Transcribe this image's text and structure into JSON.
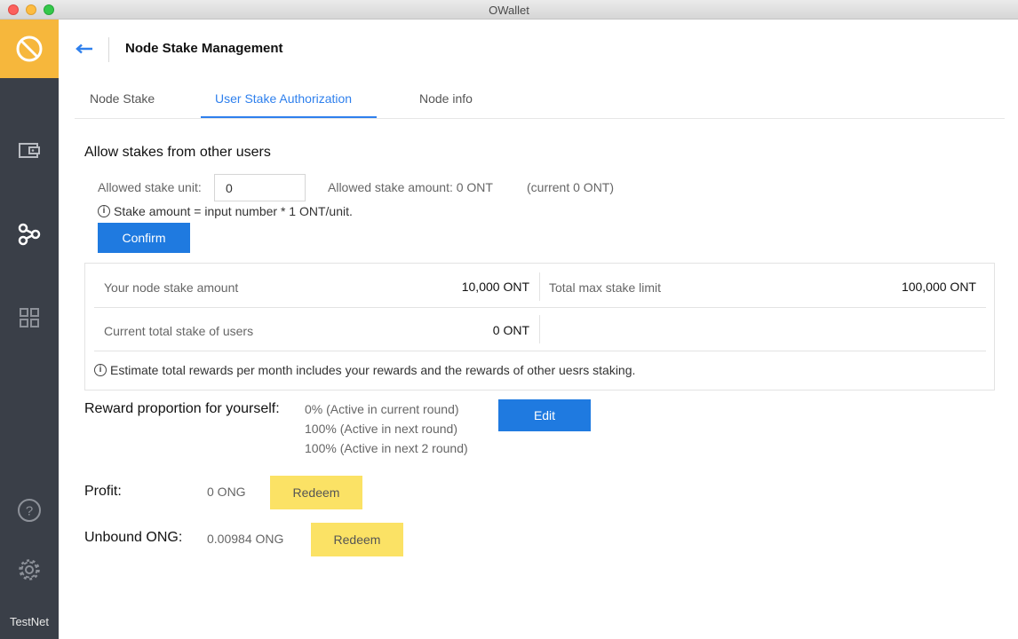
{
  "window": {
    "title": "OWallet"
  },
  "sidebar": {
    "network_label": "TestNet",
    "icons": [
      "ontology-logo-icon",
      "wallet-icon",
      "node-icon",
      "apps-grid-icon",
      "help-icon",
      "settings-icon"
    ]
  },
  "header": {
    "title": "Node Stake Management"
  },
  "tabs": [
    {
      "label": "Node Stake"
    },
    {
      "label": "User Stake Authorization",
      "active": true
    },
    {
      "label": "Node info"
    }
  ],
  "allow_section": {
    "title": "Allow stakes from other users",
    "unit_label": "Allowed stake unit:",
    "unit_value": "0",
    "allowed_amount": "Allowed stake amount: 0 ONT",
    "current": "(current 0 ONT)",
    "hint": "Stake amount = input number * 1 ONT/unit.",
    "confirm_label": "Confirm"
  },
  "stats": {
    "node_stake_label": "Your node stake amount",
    "node_stake_value": "10,000 ONT",
    "max_limit_label": "Total max stake limit",
    "max_limit_value": "100,000 ONT",
    "users_total_label": "Current total stake of users",
    "users_total_value": "0 ONT",
    "note": "Estimate total rewards per month includes your rewards and the rewards of other uesrs staking."
  },
  "reward": {
    "label": "Reward proportion for yourself:",
    "lines": [
      "0% (Active in current round)",
      "100% (Active in next round)",
      "100% (Active in next 2 round)"
    ],
    "edit_label": "Edit"
  },
  "profit": {
    "label": "Profit:",
    "value": "0 ONG",
    "redeem_label": "Redeem"
  },
  "unbound": {
    "label": "Unbound ONG:",
    "value": "0.00984 ONG",
    "redeem_label": "Redeem"
  },
  "colors": {
    "accent": "#1f7ae0",
    "logo": "#f6b73c",
    "sidebar": "#3a3f48",
    "redeem": "#fbe265"
  }
}
